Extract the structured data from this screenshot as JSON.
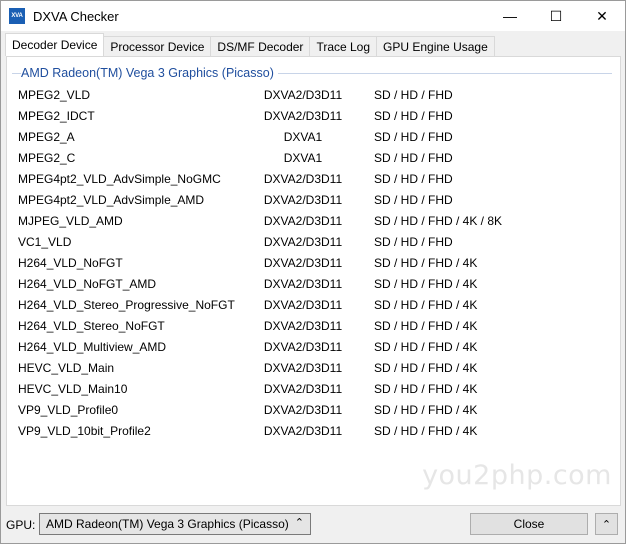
{
  "window": {
    "title": "DXVA Checker",
    "app_icon_text": "XVA",
    "caption": {
      "minimize": "—",
      "maximize": "☐",
      "close": "✕"
    }
  },
  "tabs": [
    {
      "label": "Decoder Device",
      "active": true
    },
    {
      "label": "Processor Device",
      "active": false
    },
    {
      "label": "DS/MF Decoder",
      "active": false
    },
    {
      "label": "Trace Log",
      "active": false
    },
    {
      "label": "GPU Engine Usage",
      "active": false
    }
  ],
  "group_title": "AMD Radeon(TM) Vega 3 Graphics (Picasso)",
  "decoders": [
    {
      "name": "MPEG2_VLD",
      "api": "DXVA2/D3D11",
      "res": "SD / HD / FHD"
    },
    {
      "name": "MPEG2_IDCT",
      "api": "DXVA2/D3D11",
      "res": "SD / HD / FHD"
    },
    {
      "name": "MPEG2_A",
      "api": "DXVA1",
      "res": "SD / HD / FHD"
    },
    {
      "name": "MPEG2_C",
      "api": "DXVA1",
      "res": "SD / HD / FHD"
    },
    {
      "name": "MPEG4pt2_VLD_AdvSimple_NoGMC",
      "api": "DXVA2/D3D11",
      "res": "SD / HD / FHD"
    },
    {
      "name": "MPEG4pt2_VLD_AdvSimple_AMD",
      "api": "DXVA2/D3D11",
      "res": "SD / HD / FHD"
    },
    {
      "name": "MJPEG_VLD_AMD",
      "api": "DXVA2/D3D11",
      "res": "SD / HD / FHD / 4K / 8K"
    },
    {
      "name": "VC1_VLD",
      "api": "DXVA2/D3D11",
      "res": "SD / HD / FHD"
    },
    {
      "name": "H264_VLD_NoFGT",
      "api": "DXVA2/D3D11",
      "res": "SD / HD / FHD / 4K"
    },
    {
      "name": "H264_VLD_NoFGT_AMD",
      "api": "DXVA2/D3D11",
      "res": "SD / HD / FHD / 4K"
    },
    {
      "name": "H264_VLD_Stereo_Progressive_NoFGT",
      "api": "DXVA2/D3D11",
      "res": "SD / HD / FHD / 4K"
    },
    {
      "name": "H264_VLD_Stereo_NoFGT",
      "api": "DXVA2/D3D11",
      "res": "SD / HD / FHD / 4K"
    },
    {
      "name": "H264_VLD_Multiview_AMD",
      "api": "DXVA2/D3D11",
      "res": "SD / HD / FHD / 4K"
    },
    {
      "name": "HEVC_VLD_Main",
      "api": "DXVA2/D3D11",
      "res": "SD / HD / FHD / 4K"
    },
    {
      "name": "HEVC_VLD_Main10",
      "api": "DXVA2/D3D11",
      "res": "SD / HD / FHD / 4K"
    },
    {
      "name": "VP9_VLD_Profile0",
      "api": "DXVA2/D3D11",
      "res": "SD / HD / FHD / 4K"
    },
    {
      "name": "VP9_VLD_10bit_Profile2",
      "api": "DXVA2/D3D11",
      "res": "SD / HD / FHD / 4K"
    }
  ],
  "watermark": "you2php.com",
  "bottom": {
    "gpu_label": "GPU:",
    "gpu_selected": "AMD Radeon(TM) Vega 3 Graphics (Picasso)",
    "gpu_arrow": "⌃",
    "close_label": "Close",
    "up_arrow": "⌃"
  }
}
